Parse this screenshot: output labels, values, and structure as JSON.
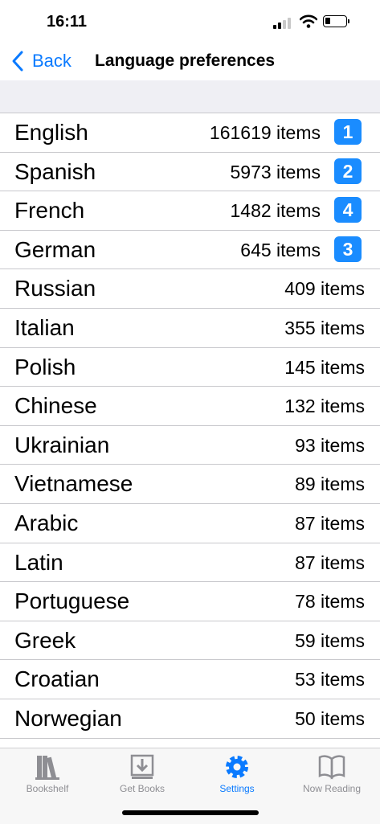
{
  "status": {
    "time": "16:11"
  },
  "nav": {
    "back_label": "Back",
    "title": "Language preferences"
  },
  "languages": [
    {
      "name": "English",
      "count": "161619 items",
      "rank": "1"
    },
    {
      "name": "Spanish",
      "count": "5973 items",
      "rank": "2"
    },
    {
      "name": "French",
      "count": "1482 items",
      "rank": "4"
    },
    {
      "name": "German",
      "count": "645 items",
      "rank": "3"
    },
    {
      "name": "Russian",
      "count": "409 items"
    },
    {
      "name": "Italian",
      "count": "355 items"
    },
    {
      "name": "Polish",
      "count": "145 items"
    },
    {
      "name": "Chinese",
      "count": "132 items"
    },
    {
      "name": "Ukrainian",
      "count": "93 items"
    },
    {
      "name": "Vietnamese",
      "count": "89 items"
    },
    {
      "name": "Arabic",
      "count": "87 items"
    },
    {
      "name": "Latin",
      "count": "87 items"
    },
    {
      "name": "Portuguese",
      "count": "78 items"
    },
    {
      "name": "Greek",
      "count": "59 items"
    },
    {
      "name": "Croatian",
      "count": "53 items"
    },
    {
      "name": "Norwegian",
      "count": "50 items"
    }
  ],
  "tabs": [
    {
      "label": "Bookshelf",
      "icon": "bookshelf-icon"
    },
    {
      "label": "Get Books",
      "icon": "download-icon"
    },
    {
      "label": "Settings",
      "icon": "gear-icon",
      "active": true
    },
    {
      "label": "Now Reading",
      "icon": "open-book-icon"
    }
  ],
  "colors": {
    "accent": "#0a7aff",
    "badge": "#1a8cff",
    "section_bg": "#efeff4"
  }
}
